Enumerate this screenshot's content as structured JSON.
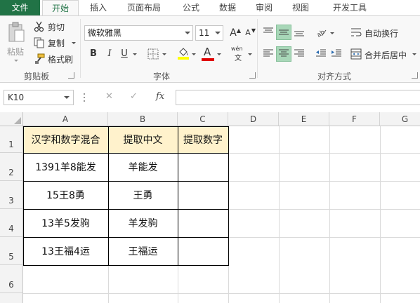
{
  "tabs": [
    {
      "label": "文件"
    },
    {
      "label": "开始"
    },
    {
      "label": "插入"
    },
    {
      "label": "页面布局"
    },
    {
      "label": "公式"
    },
    {
      "label": "数据"
    },
    {
      "label": "审阅"
    },
    {
      "label": "视图"
    },
    {
      "label": "开发工具"
    }
  ],
  "clipboard": {
    "paste_label": "粘贴",
    "cut_label": "剪切",
    "copy_label": "复制",
    "format_painter_label": "格式刷",
    "group_label": "剪贴板"
  },
  "font": {
    "name": "微软雅黑",
    "size": "11",
    "bold": "B",
    "italic": "I",
    "underline": "U",
    "font_color_glyph": "A",
    "wen_glyph": "wén",
    "wen_sub": "文",
    "grow_glyph": "A",
    "shrink_glyph": "A",
    "group_label": "字体"
  },
  "alignment": {
    "wrap_text_label": "自动换行",
    "merge_center_label": "合并后居中",
    "group_label": "对齐方式"
  },
  "formula_bar": {
    "name_box": "K10",
    "cancel_glyph": "✕",
    "enter_glyph": "✓",
    "fx_glyph": "fx",
    "formula": ""
  },
  "sheet": {
    "columns": [
      "A",
      "B",
      "C",
      "D",
      "E",
      "F",
      "G"
    ],
    "rows": [
      "1",
      "2",
      "3",
      "4",
      "5",
      "6"
    ],
    "header": [
      "汉字和数字混合",
      "提取中文",
      "提取数字"
    ],
    "data": [
      [
        "1391羊8能发",
        "羊能发",
        ""
      ],
      [
        "15王8勇",
        "王勇",
        ""
      ],
      [
        "13羊5发驹",
        "羊发驹",
        ""
      ],
      [
        "13王福4运",
        "王福运",
        ""
      ]
    ]
  },
  "colors": {
    "accent": "#217346",
    "header_fill": "#fff2cc",
    "selected_align": "#a8d7b8",
    "font_color_bar": "#e00000",
    "fill_color_bar": "#ffff00"
  }
}
